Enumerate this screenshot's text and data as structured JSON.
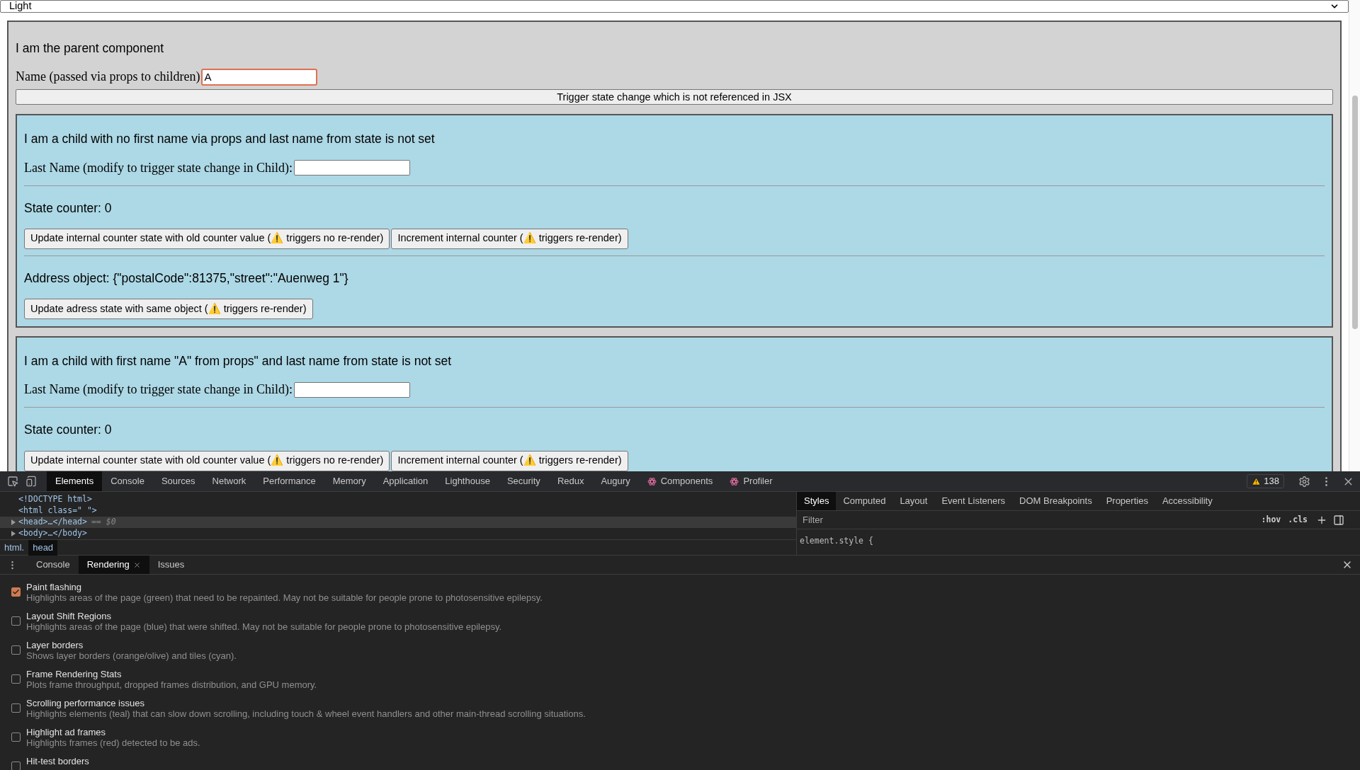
{
  "theme_select": {
    "value": "Light"
  },
  "parent": {
    "heading": "I am the parent component",
    "name_label": "Name (passed via props to children)",
    "name_value": "A",
    "trigger_button": "Trigger state change which is not referenced in JSX"
  },
  "children": [
    {
      "heading": "I am a child with no first name via props and last name from state is not set",
      "last_name_label": "Last Name (modify to trigger state change in Child):",
      "counter": "State counter: 0",
      "buttons": [
        "Update internal counter state with old counter value (⚠️ triggers no re-render)",
        "Increment internal counter (⚠️ triggers re-render)"
      ],
      "address": "Address object: {\"postalCode\":81375,\"street\":\"Auenweg 1\"}",
      "address_button": "Update adress state with same object (⚠️ triggers re-render)"
    },
    {
      "heading": "I am a child with first name \"A\" from props\" and last name from state is not set",
      "last_name_label": "Last Name (modify to trigger state change in Child):",
      "counter": "State counter: 0",
      "buttons": [
        "Update internal counter state with old counter value (⚠️ triggers no re-render)",
        "Increment internal counter (⚠️ triggers re-render)"
      ]
    }
  ],
  "devtools": {
    "tabs": [
      {
        "label": "Elements",
        "selected": true,
        "kind": "plain"
      },
      {
        "label": "Console",
        "selected": false,
        "kind": "plain"
      },
      {
        "label": "Sources",
        "selected": false,
        "kind": "plain"
      },
      {
        "label": "Network",
        "selected": false,
        "kind": "plain"
      },
      {
        "label": "Performance",
        "selected": false,
        "kind": "plain"
      },
      {
        "label": "Memory",
        "selected": false,
        "kind": "plain"
      },
      {
        "label": "Application",
        "selected": false,
        "kind": "plain"
      },
      {
        "label": "Lighthouse",
        "selected": false,
        "kind": "plain"
      },
      {
        "label": "Security",
        "selected": false,
        "kind": "plain"
      },
      {
        "label": "Redux",
        "selected": false,
        "kind": "plain"
      },
      {
        "label": "Augury",
        "selected": false,
        "kind": "plain"
      },
      {
        "label": "Components",
        "selected": false,
        "kind": "react"
      },
      {
        "label": "Profiler",
        "selected": false,
        "kind": "react"
      }
    ],
    "warning_count": "138",
    "dom_lines": [
      {
        "text": "<!DOCTYPE html>",
        "selected": false,
        "expandable": false
      },
      {
        "text": "<html class=\" \">",
        "selected": false,
        "expandable": false
      },
      {
        "text": "<head>…</head>",
        "suffix": "== $0",
        "selected": true,
        "expandable": true
      },
      {
        "text": "<body>…</body>",
        "selected": false,
        "expandable": true
      }
    ],
    "breadcrumbs": [
      {
        "label": "html.",
        "selected": false
      },
      {
        "label": "head",
        "selected": true
      }
    ],
    "styles_tabs": [
      {
        "label": "Styles",
        "selected": true
      },
      {
        "label": "Computed",
        "selected": false
      },
      {
        "label": "Layout",
        "selected": false
      },
      {
        "label": "Event Listeners",
        "selected": false
      },
      {
        "label": "DOM Breakpoints",
        "selected": false
      },
      {
        "label": "Properties",
        "selected": false
      },
      {
        "label": "Accessibility",
        "selected": false
      }
    ],
    "filter_placeholder": "Filter",
    "hov": ":hov",
    "cls": ".cls",
    "element_style": "element.style {",
    "drawer_tabs": [
      {
        "label": "Console",
        "selected": false,
        "closable": false
      },
      {
        "label": "Rendering",
        "selected": true,
        "closable": true
      },
      {
        "label": "Issues",
        "selected": false,
        "closable": false
      }
    ],
    "rendering_options": [
      {
        "title": "Paint flashing",
        "description": "Highlights areas of the page (green) that need to be repainted. May not be suitable for people prone to photosensitive epilepsy.",
        "checked": true
      },
      {
        "title": "Layout Shift Regions",
        "description": "Highlights areas of the page (blue) that were shifted. May not be suitable for people prone to photosensitive epilepsy.",
        "checked": false
      },
      {
        "title": "Layer borders",
        "description": "Shows layer borders (orange/olive) and tiles (cyan).",
        "checked": false
      },
      {
        "title": "Frame Rendering Stats",
        "description": "Plots frame throughput, dropped frames distribution, and GPU memory.",
        "checked": false
      },
      {
        "title": "Scrolling performance issues",
        "description": "Highlights elements (teal) that can slow down scrolling, including touch & wheel event handlers and other main-thread scrolling situations.",
        "checked": false
      },
      {
        "title": "Highlight ad frames",
        "description": "Highlights frames (red) detected to be ads.",
        "checked": false
      },
      {
        "title": "Hit-test borders",
        "checked": false
      }
    ]
  }
}
